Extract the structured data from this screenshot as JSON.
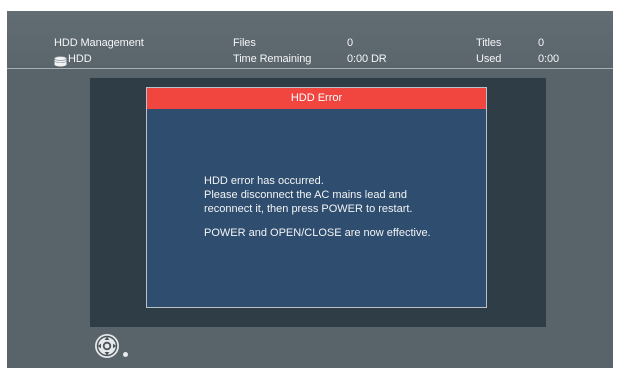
{
  "header": {
    "title": "HDD Management",
    "drive_label": "HDD",
    "files_label": "Files",
    "files_value": "0",
    "time_remaining_label": "Time Remaining",
    "time_remaining_value": "0:00 DR",
    "titles_label": "Titles",
    "titles_value": "0",
    "used_label": "Used",
    "used_value": "0:00",
    "icons": [
      "hdd-icon"
    ]
  },
  "dialog": {
    "title": "HDD Error",
    "lines": [
      "HDD error has occurred.",
      "Please disconnect the AC mains lead and",
      "reconnect it, then press POWER to restart.",
      "POWER and OPEN/CLOSE are now effective."
    ]
  },
  "footer": {
    "icons": [
      "remote-navigation-icon"
    ]
  },
  "colors": {
    "screen_background": "#59636a",
    "panel_background": "#2f3d47",
    "dialog_background": "#2f4d6e",
    "dialog_title_background": "#f1453f",
    "text": "#f4f6f7"
  }
}
